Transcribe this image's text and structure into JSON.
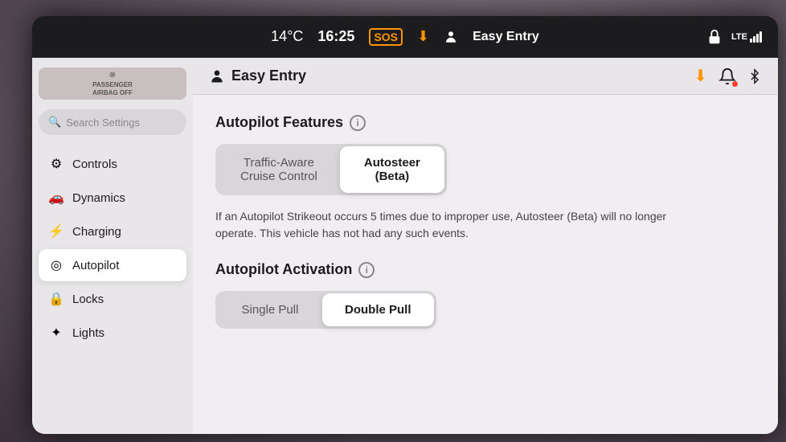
{
  "screen": {
    "status_bar": {
      "temperature": "14°C",
      "time": "16:25",
      "sos_label": "SOS",
      "easy_entry_label": "Easy Entry"
    },
    "secondary_bar": {
      "easy_entry_label": "Easy Entry"
    },
    "sidebar": {
      "search_placeholder": "Search Settings",
      "passenger_airbag_label": "PASSENGER\nAIRBAG OFF",
      "nav_items": [
        {
          "id": "controls",
          "label": "Controls",
          "icon": "⚙"
        },
        {
          "id": "dynamics",
          "label": "Dynamics",
          "icon": "🚗"
        },
        {
          "id": "charging",
          "label": "Charging",
          "icon": "⚡"
        },
        {
          "id": "autopilot",
          "label": "Autopilot",
          "icon": "🎯",
          "active": true
        },
        {
          "id": "locks",
          "label": "Locks",
          "icon": "🔒"
        },
        {
          "id": "lights",
          "label": "Lights",
          "icon": "✦"
        }
      ]
    },
    "content": {
      "autopilot_features": {
        "title": "Autopilot Features",
        "info_icon": "i",
        "options": [
          {
            "id": "traffic_aware",
            "label": "Traffic-Aware\nCruise Control",
            "active": false
          },
          {
            "id": "autosteer",
            "label": "Autosteer\n(Beta)",
            "active": true
          }
        ],
        "description": "If an Autopilot Strikeout occurs 5 times due to improper use, Autosteer (Beta) will no longer operate. This vehicle has not had any such events."
      },
      "autopilot_activation": {
        "title": "Autopilot Activation",
        "info_icon": "i",
        "options": [
          {
            "id": "single_pull",
            "label": "Single Pull",
            "active": false
          },
          {
            "id": "double_pull",
            "label": "Double Pull",
            "active": true
          }
        ]
      }
    }
  }
}
